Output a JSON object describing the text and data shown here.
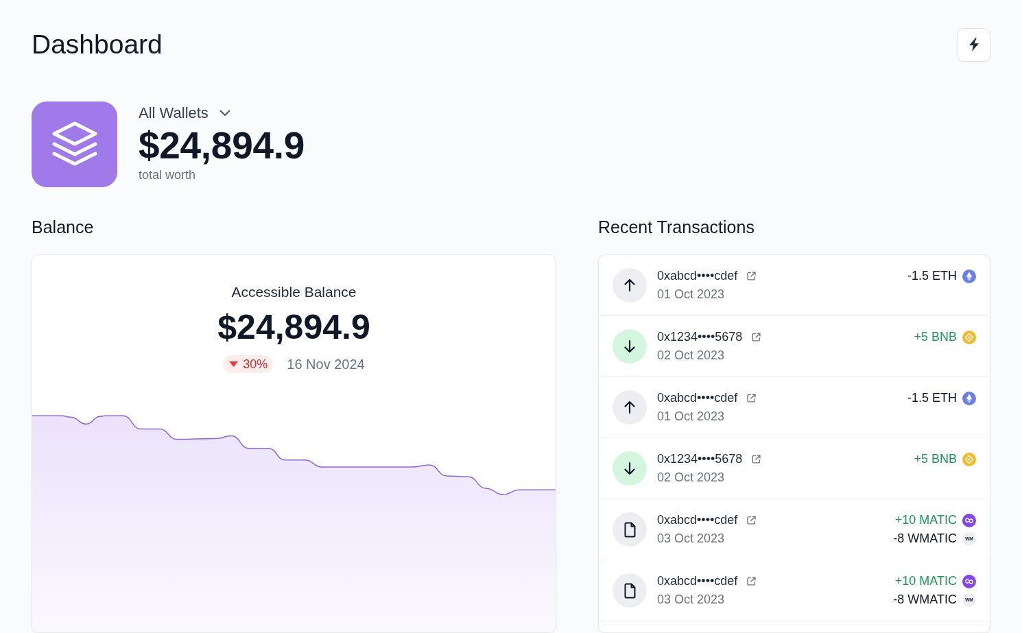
{
  "page": {
    "title": "Dashboard"
  },
  "wallet": {
    "selector": "All Wallets",
    "total": "$24,894.9",
    "caption": "total worth"
  },
  "balance": {
    "heading": "Balance",
    "label": "Accessible Balance",
    "value": "$24,894.9",
    "change": {
      "text": "30%",
      "kind": "down"
    },
    "date": "16 Nov 2024"
  },
  "transactions": {
    "heading": "Recent Transactions",
    "items": [
      {
        "kind": "send",
        "address": "0xabcd••••cdef",
        "date": "01 Oct 2023",
        "amounts": [
          {
            "text": "-1.5 ETH",
            "credit": false,
            "kind": "eth"
          }
        ]
      },
      {
        "kind": "receive",
        "address": "0x1234••••5678",
        "date": "02 Oct 2023",
        "amounts": [
          {
            "text": "+5 BNB",
            "credit": true,
            "kind": "bnb"
          }
        ]
      },
      {
        "kind": "send",
        "address": "0xabcd••••cdef",
        "date": "01 Oct 2023",
        "amounts": [
          {
            "text": "-1.5 ETH",
            "credit": false,
            "kind": "eth"
          }
        ]
      },
      {
        "kind": "receive",
        "address": "0x1234••••5678",
        "date": "02 Oct 2023",
        "amounts": [
          {
            "text": "+5 BNB",
            "credit": true,
            "kind": "bnb"
          }
        ]
      },
      {
        "kind": "contract",
        "address": "0xabcd••••cdef",
        "date": "03 Oct 2023",
        "amounts": [
          {
            "text": "+10 MATIC",
            "credit": true,
            "kind": "matic"
          },
          {
            "text": "-8 WMATIC",
            "credit": false,
            "kind": "wm",
            "logo": "WM"
          }
        ]
      },
      {
        "kind": "contract",
        "address": "0xabcd••••cdef",
        "date": "03 Oct 2023",
        "amounts": [
          {
            "text": "+10 MATIC",
            "credit": true,
            "kind": "matic"
          },
          {
            "text": "-8 WMATIC",
            "credit": false,
            "kind": "wm",
            "logo": "WM"
          }
        ]
      }
    ]
  }
}
